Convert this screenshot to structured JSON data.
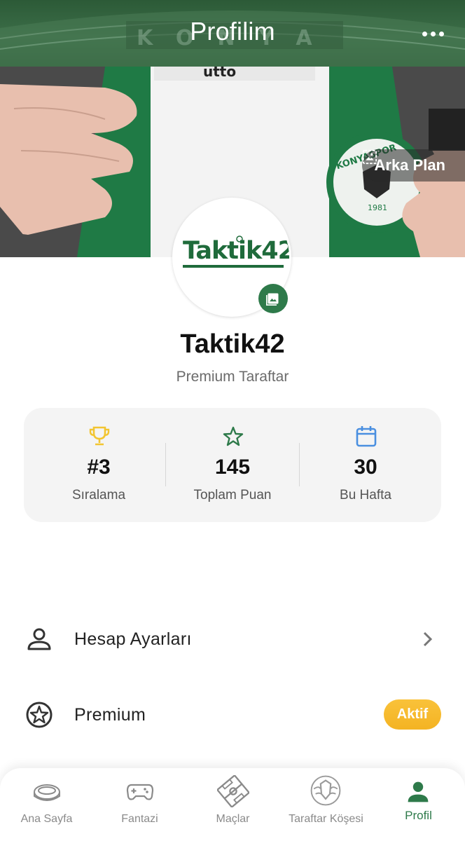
{
  "header": {
    "title": "Profilim",
    "stadium_sign": "KONYA"
  },
  "cover": {
    "background_button_label": "Arka Plan",
    "jersey_sponsor": "utto",
    "crest_text": "KONYASPOR",
    "crest_year": "1981"
  },
  "profile": {
    "logo_text": "Taktik42",
    "username": "Taktik42",
    "membership": "Premium Taraftar"
  },
  "stats": [
    {
      "icon": "trophy-icon",
      "value": "#3",
      "label": "Sıralama",
      "color": "#f2c531"
    },
    {
      "icon": "star-outline-icon",
      "value": "145",
      "label": "Toplam Puan",
      "color": "#2e7a4a"
    },
    {
      "icon": "calendar-icon",
      "value": "30",
      "label": "Bu Hafta",
      "color": "#4a8fe0"
    }
  ],
  "menu": {
    "account_settings_label": "Hesap Ayarları",
    "premium_label": "Premium",
    "premium_badge": "Aktif"
  },
  "bottom_nav": [
    {
      "icon": "stadium-icon",
      "label": "Ana Sayfa",
      "active": false
    },
    {
      "icon": "gamepad-icon",
      "label": "Fantazi",
      "active": false
    },
    {
      "icon": "pitch-icon",
      "label": "Maçlar",
      "active": false
    },
    {
      "icon": "eagle-crest-icon",
      "label": "Taraftar Köşesi",
      "active": false
    },
    {
      "icon": "person-icon",
      "label": "Profil",
      "active": true
    }
  ],
  "colors": {
    "brand_green": "#2e7a4a",
    "badge_yellow": "#f4b323",
    "trophy_gold": "#f2c531",
    "calendar_blue": "#4a8fe0"
  }
}
